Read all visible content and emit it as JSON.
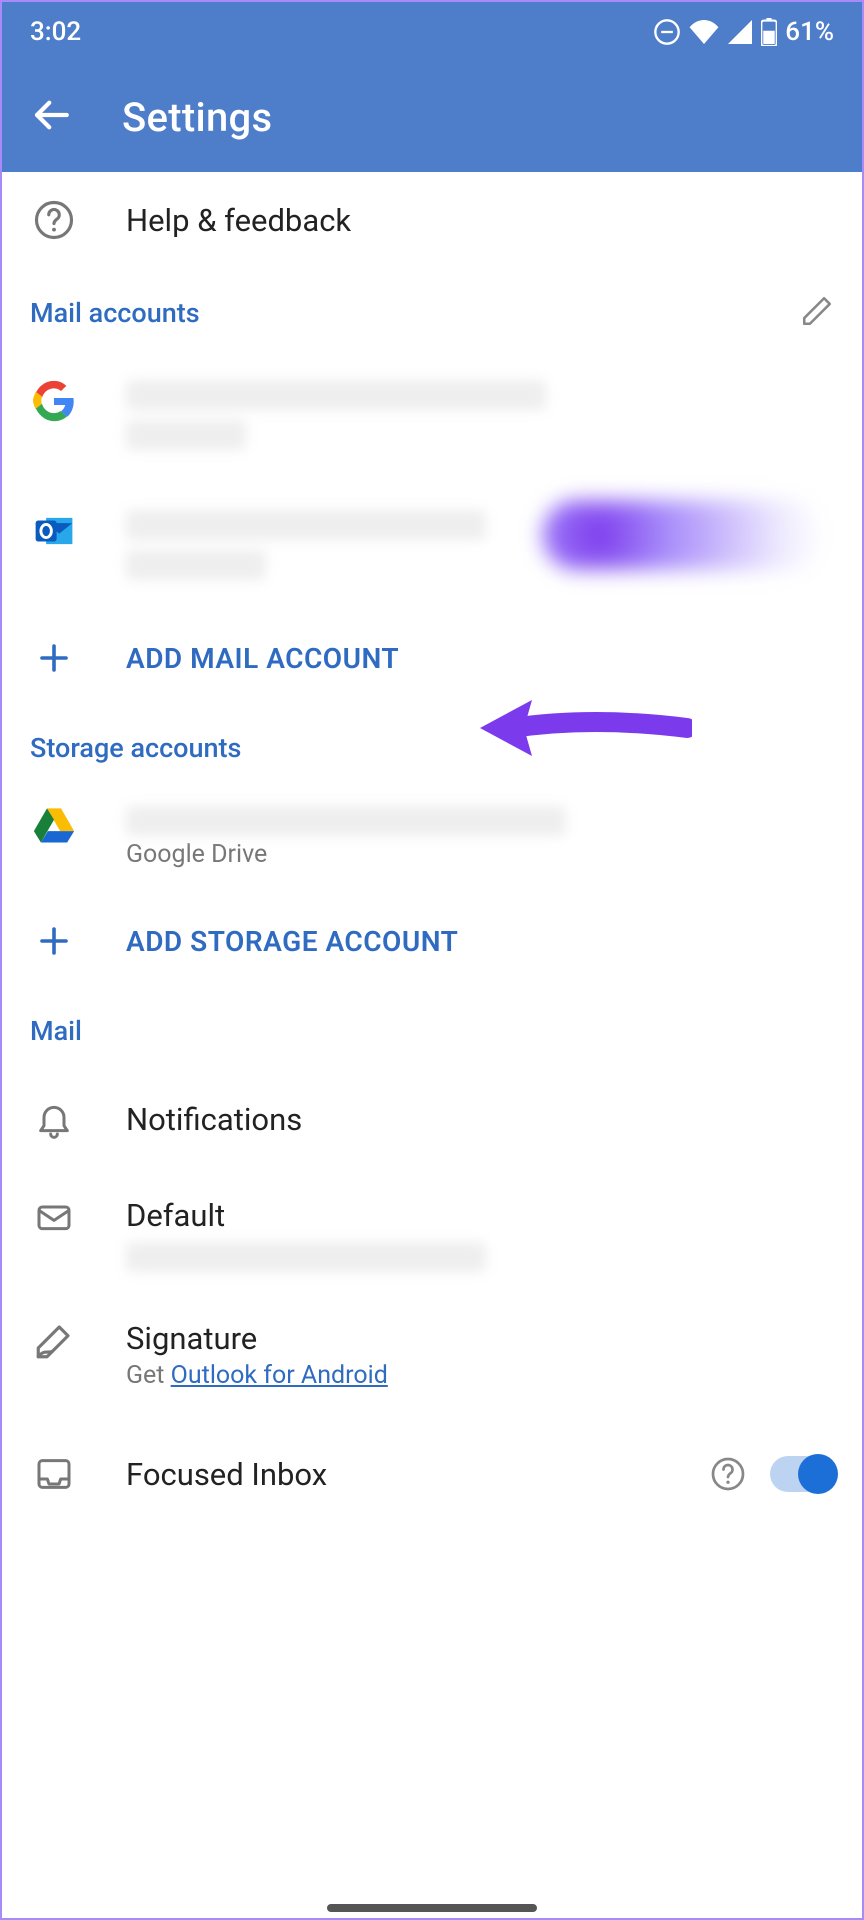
{
  "status": {
    "time": "3:02",
    "battery": "61%"
  },
  "header": {
    "title": "Settings"
  },
  "help": {
    "label": "Help & feedback"
  },
  "sections": {
    "mail_accounts": {
      "label": "Mail accounts",
      "add_label": "ADD MAIL ACCOUNT"
    },
    "storage_accounts": {
      "label": "Storage accounts",
      "drive_sub": "Google Drive",
      "add_label": "ADD STORAGE ACCOUNT"
    },
    "mail": {
      "label": "Mail",
      "notifications": "Notifications",
      "default": "Default",
      "signature_title": "Signature",
      "signature_prefix": "Get ",
      "signature_link": "Outlook for Android",
      "focused": "Focused Inbox"
    }
  }
}
